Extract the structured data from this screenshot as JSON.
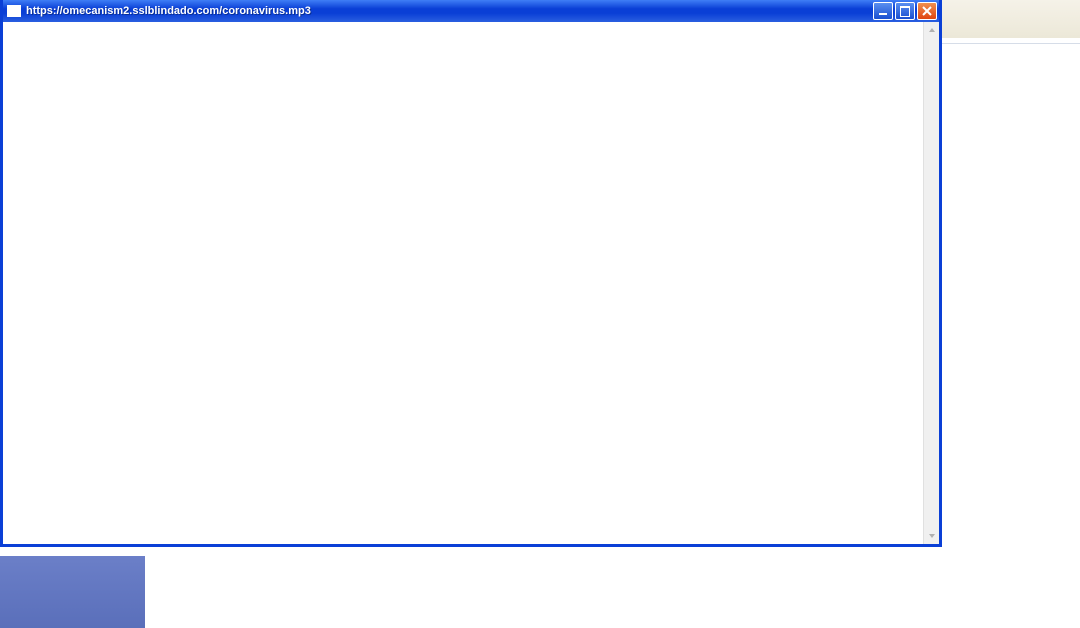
{
  "window": {
    "title": "https://omecanism2.sslblindado.com/coronavirus.mp3",
    "controls": {
      "minimize": "Minimize",
      "maximize": "Maximize",
      "close": "Close"
    }
  }
}
